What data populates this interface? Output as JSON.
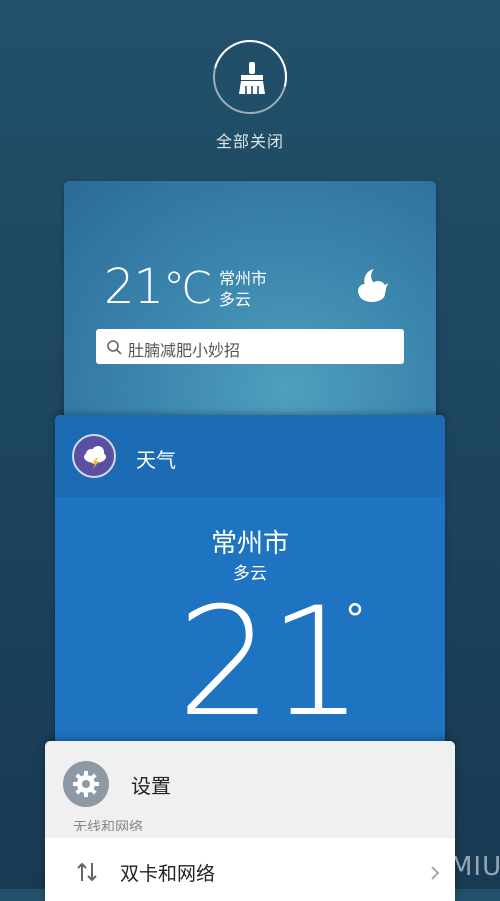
{
  "close_all": {
    "label": "全部关闭",
    "icon": "broom-icon"
  },
  "weather_widget": {
    "temperature": "21",
    "unit": "℃",
    "city": "常州市",
    "condition": "多云",
    "condition_icon": "moon-cloud-icon",
    "search_placeholder": "肚腩减肥小妙招"
  },
  "weather_app": {
    "app_name": "天气",
    "app_icon": "thunder-cloud-icon",
    "city": "常州市",
    "condition": "多云",
    "temperature": "21",
    "degree_symbol": "°"
  },
  "settings_app": {
    "app_name": "设置",
    "app_icon": "gear-icon",
    "section_header": "无线和网络",
    "rows": [
      {
        "label": "双卡和网络",
        "icon": "data-arrows-icon"
      }
    ]
  },
  "watermark": "MIUI",
  "colors": {
    "background": "#1d4660",
    "widget_card": "#3b86ae",
    "weather_card": "#1f74c1",
    "settings_card": "#f0f0f0"
  }
}
